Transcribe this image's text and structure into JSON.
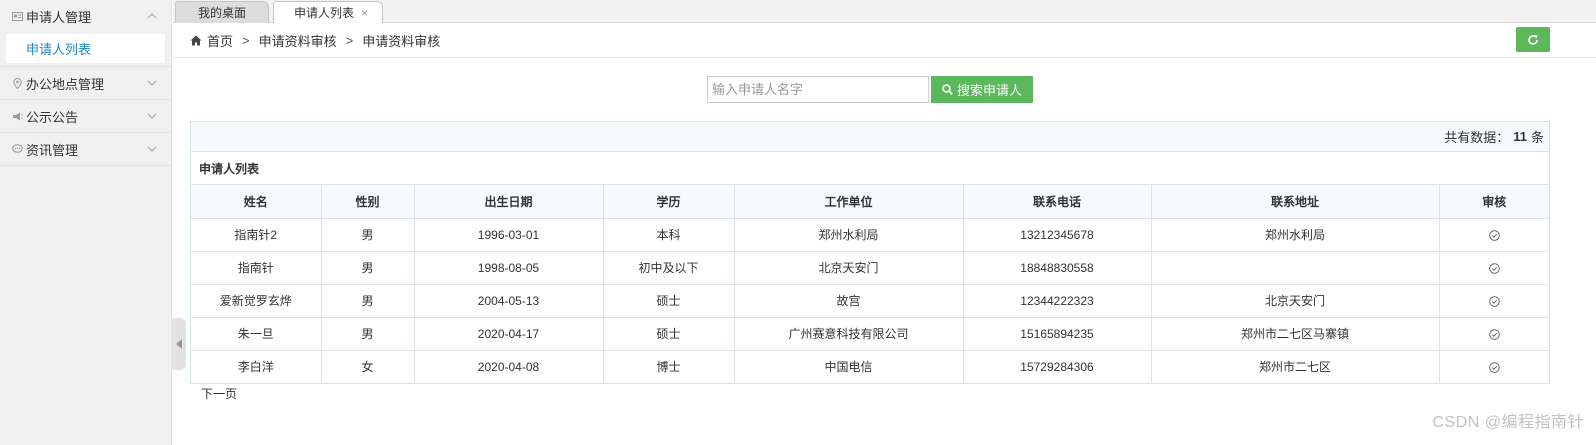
{
  "sidebar": {
    "groups": [
      {
        "label": "申请人管理",
        "icon": "id-card-icon",
        "expanded": true,
        "items": [
          {
            "label": "申请人列表"
          }
        ]
      },
      {
        "label": "办公地点管理",
        "icon": "map-marker-icon",
        "expanded": false
      },
      {
        "label": "公示公告",
        "icon": "megaphone-icon",
        "expanded": false
      },
      {
        "label": "资讯管理",
        "icon": "chat-bubble-icon",
        "expanded": false
      }
    ]
  },
  "tabs": [
    {
      "label": "我的桌面",
      "active": false
    },
    {
      "label": "申请人列表",
      "active": true,
      "closable": true
    }
  ],
  "breadcrumb": {
    "home": "首页",
    "items": [
      "申请资料审核",
      "申请资料审核"
    ],
    "separator": ">"
  },
  "search": {
    "placeholder": "输入申请人名字",
    "button_label": "搜索申请人"
  },
  "summary": {
    "prefix": "共有数据：",
    "count": "11",
    "suffix": "条"
  },
  "panel_title": "申请人列表",
  "table": {
    "headers": [
      "姓名",
      "性别",
      "出生日期",
      "学历",
      "工作单位",
      "联系电话",
      "联系地址",
      "审核"
    ],
    "rows": [
      [
        "指南针2",
        "男",
        "1996-03-01",
        "本科",
        "郑州水利局",
        "13212345678",
        "郑州水利局"
      ],
      [
        "指南针",
        "男",
        "1998-08-05",
        "初中及以下",
        "北京天安门",
        "18848830558",
        ""
      ],
      [
        "爱新觉罗玄烨",
        "男",
        "2004-05-13",
        "硕士",
        "故宫",
        "12344222323",
        "北京天安门"
      ],
      [
        "朱一旦",
        "男",
        "2020-04-17",
        "硕士",
        "广州赛意科技有限公司",
        "15165894235",
        "郑州市二七区马寨镇"
      ],
      [
        "李白洋",
        "女",
        "2020-04-08",
        "博士",
        "中国电信",
        "15729284306",
        "郑州市二七区"
      ]
    ]
  },
  "pagination": {
    "next_label": "下一页"
  },
  "watermark": "CSDN @编程指南针",
  "colors": {
    "accent_green": "#5cb85c",
    "link_blue": "#1e88c7",
    "sidebar_bg": "#f0f0f0"
  }
}
